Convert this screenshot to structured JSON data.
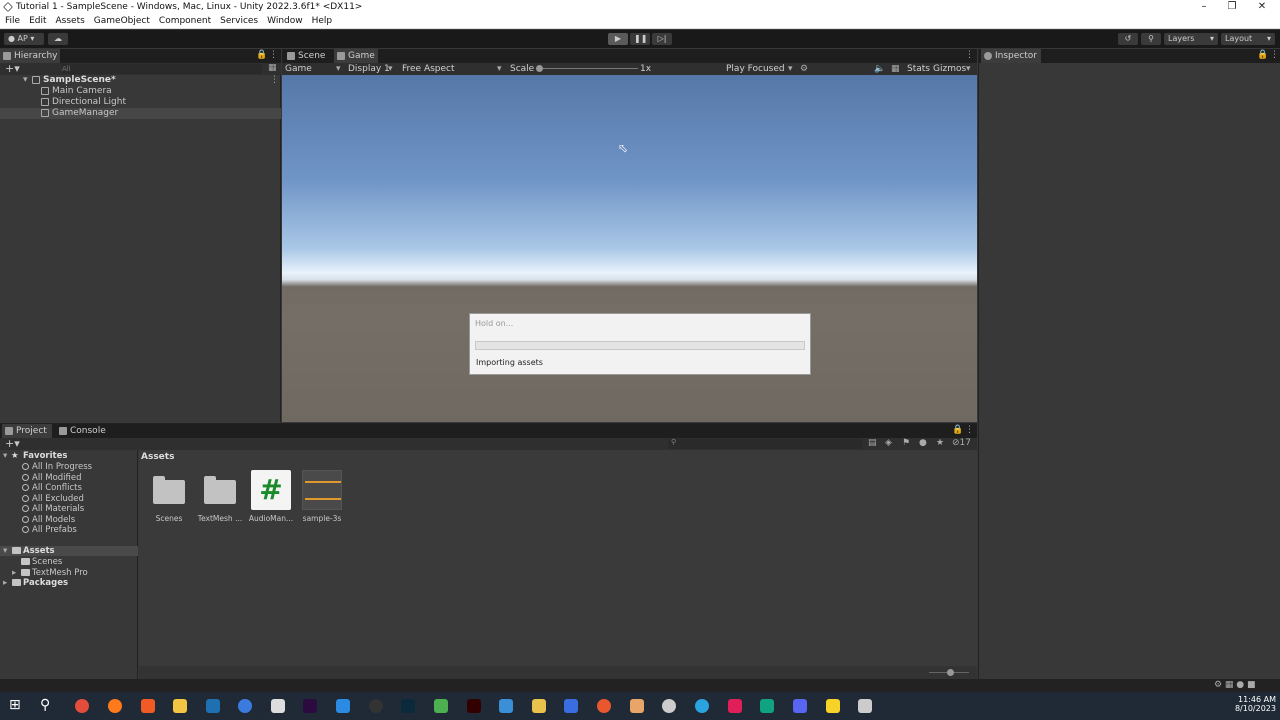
{
  "window": {
    "title": "Tutorial 1 - SampleScene - Windows, Mac, Linux - Unity 2022.3.6f1* <DX11>"
  },
  "menu": [
    "File",
    "Edit",
    "Assets",
    "GameObject",
    "Component",
    "Services",
    "Window",
    "Help"
  ],
  "toolbar": {
    "account": "AP",
    "layers": "Layers",
    "layout": "Layout"
  },
  "hierarchy": {
    "tab": "Hierarchy",
    "search_placeholder": "All",
    "scene": "SampleScene*",
    "items": [
      "Main Camera",
      "Directional Light",
      "GameManager"
    ]
  },
  "game_view": {
    "tabs": [
      "Scene",
      "Game"
    ],
    "mode": "Game",
    "display": "Display 1",
    "aspect": "Free Aspect",
    "scale_label": "Scale",
    "scale_value": "1x",
    "play_focused": "Play Focused",
    "stats": "Stats",
    "gizmos": "Gizmos"
  },
  "dialog": {
    "title": "Hold on...",
    "message": "Importing assets",
    "progress": 0
  },
  "inspector": {
    "tab": "Inspector"
  },
  "project": {
    "tabs": [
      "Project",
      "Console"
    ],
    "hidden_count": "17",
    "favorites_label": "Favorites",
    "favorites": [
      "All In Progress",
      "All Modified",
      "All Conflicts",
      "All Excluded",
      "All Materials",
      "All Models",
      "All Prefabs"
    ],
    "assets_label": "Assets",
    "asset_folders": [
      "Scenes",
      "TextMesh Pro"
    ],
    "packages_label": "Packages",
    "breadcrumb": "Assets",
    "items": [
      {
        "name": "Scenes",
        "kind": "folder"
      },
      {
        "name": "TextMesh ...",
        "kind": "folder"
      },
      {
        "name": "AudioMan...",
        "kind": "script"
      },
      {
        "name": "sample-3s",
        "kind": "audio"
      }
    ]
  },
  "clock": {
    "time": "11:46 AM",
    "date": "8/10/2023"
  }
}
